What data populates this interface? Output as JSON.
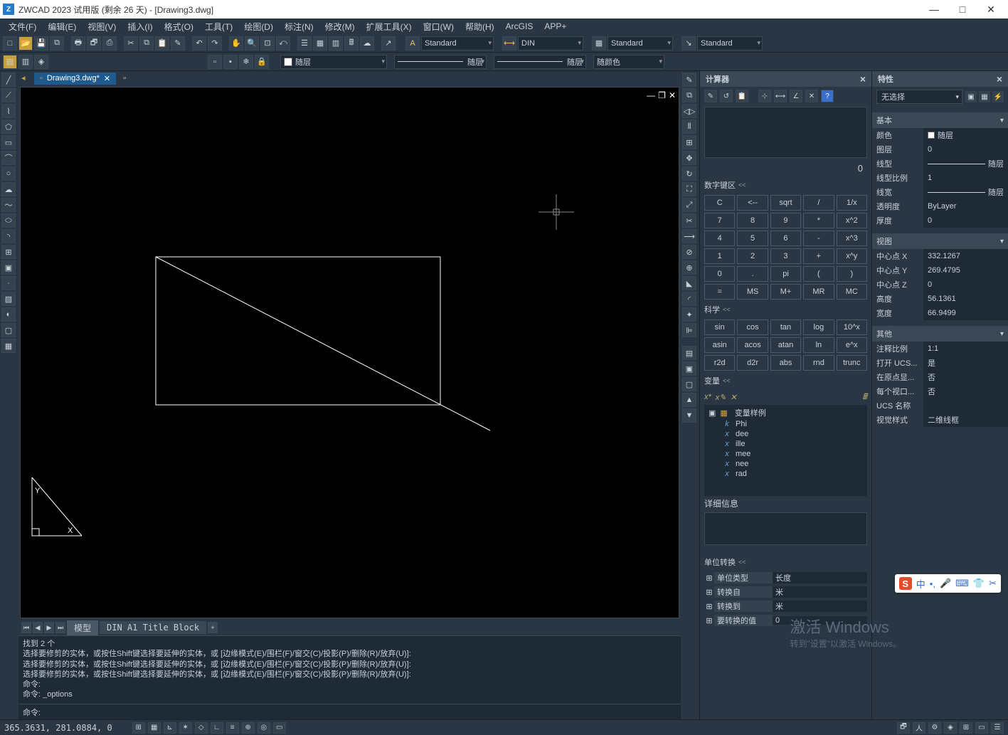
{
  "titlebar": {
    "text": "ZWCAD 2023 试用版 (剩余 26 天) - [Drawing3.dwg]"
  },
  "menu": [
    "文件(F)",
    "编辑(E)",
    "视图(V)",
    "插入(I)",
    "格式(O)",
    "工具(T)",
    "绘图(D)",
    "标注(N)",
    "修改(M)",
    "扩展工具(X)",
    "窗口(W)",
    "帮助(H)",
    "ArcGIS",
    "APP+"
  ],
  "style_combos": {
    "text_style": "Standard",
    "dim_style": "DIN",
    "table_style": "Standard",
    "mleader_style": "Standard"
  },
  "layer_row": {
    "layer": "随层",
    "linetype": "随层",
    "lineweight": "随层",
    "color": "随颜色"
  },
  "doc_tab": {
    "label": "Drawing3.dwg*"
  },
  "bottom_tabs": {
    "model": "模型",
    "layout": "DIN A1 Title Block"
  },
  "cmd_history": [
    "找到 2 个",
    "选择要修剪的实体，或按住Shift键选择要延伸的实体，或 [边缘模式(E)/围栏(F)/窗交(C)/投影(P)/删除(R)/放弃(U)]:",
    "选择要修剪的实体，或按住Shift键选择要延伸的实体，或 [边缘模式(E)/围栏(F)/窗交(C)/投影(P)/删除(R)/放弃(U)]:",
    "选择要修剪的实体，或按住Shift键选择要延伸的实体，或 [边缘模式(E)/围栏(F)/窗交(C)/投影(P)/删除(R)/放弃(U)]:",
    "命令:",
    "命令: _options"
  ],
  "cmd_prompt": "命令: ",
  "calculator": {
    "title": "计算器",
    "result": "0",
    "sections": {
      "numpad": "数字键区",
      "sci": "科学",
      "vars": "变量",
      "units": "单位转换"
    },
    "collapse": "<<",
    "numpad": [
      [
        "C",
        "<--",
        "sqrt",
        "/",
        "1/x"
      ],
      [
        "7",
        "8",
        "9",
        "*",
        "x^2"
      ],
      [
        "4",
        "5",
        "6",
        "-",
        "x^3"
      ],
      [
        "1",
        "2",
        "3",
        "+",
        "x^y"
      ],
      [
        "0",
        ".",
        "pi",
        "(",
        ")"
      ],
      [
        "=",
        "MS",
        "M+",
        "MR",
        "MC"
      ]
    ],
    "sci": [
      [
        "sin",
        "cos",
        "tan",
        "log",
        "10^x"
      ],
      [
        "asin",
        "acos",
        "atan",
        "ln",
        "e^x"
      ],
      [
        "r2d",
        "d2r",
        "abs",
        "rnd",
        "trunc"
      ]
    ],
    "var_folder": "变量样例",
    "vars": [
      {
        "sym": "k",
        "name": "Phi"
      },
      {
        "sym": "x",
        "name": "dee"
      },
      {
        "sym": "x",
        "name": "ille"
      },
      {
        "sym": "x",
        "name": "mee"
      },
      {
        "sym": "x",
        "name": "nee"
      },
      {
        "sym": "x",
        "name": "rad"
      }
    ],
    "detail_label": "详细信息",
    "unit_rows": [
      {
        "k": "单位类型",
        "v": "长度"
      },
      {
        "k": "转换自",
        "v": "米"
      },
      {
        "k": "转换到",
        "v": "米"
      },
      {
        "k": "要转换的值",
        "v": "0"
      }
    ]
  },
  "properties": {
    "title": "特性",
    "selection": "无选择",
    "sections": {
      "basic": {
        "title": "基本",
        "rows": [
          {
            "k": "颜色",
            "v": "随层",
            "swatch": true
          },
          {
            "k": "图层",
            "v": "0"
          },
          {
            "k": "线型",
            "v": "随层",
            "line": true
          },
          {
            "k": "线型比例",
            "v": "1"
          },
          {
            "k": "线宽",
            "v": "随层",
            "line": true
          },
          {
            "k": "透明度",
            "v": "ByLayer"
          },
          {
            "k": "厚度",
            "v": "0"
          }
        ]
      },
      "view": {
        "title": "视图",
        "rows": [
          {
            "k": "中心点 X",
            "v": "332.1267"
          },
          {
            "k": "中心点 Y",
            "v": "269.4795"
          },
          {
            "k": "中心点 Z",
            "v": "0"
          },
          {
            "k": "高度",
            "v": "56.1361"
          },
          {
            "k": "宽度",
            "v": "66.9499"
          }
        ]
      },
      "other": {
        "title": "其他",
        "rows": [
          {
            "k": "注释比例",
            "v": "1:1"
          },
          {
            "k": "打开 UCS...",
            "v": "是"
          },
          {
            "k": "在原点显...",
            "v": "否"
          },
          {
            "k": "每个视口...",
            "v": "否"
          },
          {
            "k": "UCS 名称",
            "v": ""
          },
          {
            "k": "视觉样式",
            "v": "二维线框"
          }
        ]
      }
    }
  },
  "status": {
    "coords": "365.3631, 281.0884, 0"
  },
  "watermark": {
    "l1": "激活 Windows",
    "l2": "转到\"设置\"以激活 Windows。"
  },
  "ime": {
    "char": "中"
  }
}
